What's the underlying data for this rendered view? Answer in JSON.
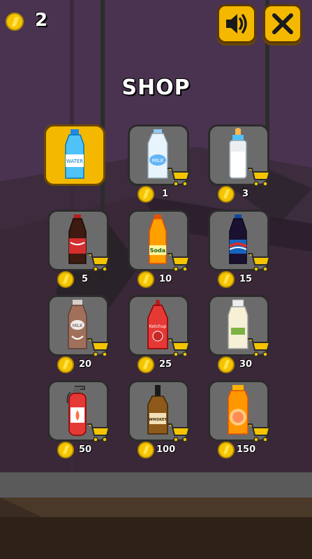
{
  "hud": {
    "coins": "2"
  },
  "header": {
    "title": "SHOP"
  },
  "buttons": {
    "sound_icon": "speaker-icon",
    "close_icon": "close-x-icon"
  },
  "items": [
    {
      "name": "water",
      "label": "WATER",
      "price": "",
      "selected": true
    },
    {
      "name": "milk",
      "label": "MILK",
      "price": "1"
    },
    {
      "name": "baby-bottle",
      "label": "",
      "price": "3"
    },
    {
      "name": "cola",
      "label": "",
      "price": "5"
    },
    {
      "name": "soda",
      "label": "Soda",
      "price": "10"
    },
    {
      "name": "pepsi",
      "label": "",
      "price": "15"
    },
    {
      "name": "choco-milk",
      "label": "MILK",
      "price": "20"
    },
    {
      "name": "ketchup",
      "label": "Ketchup",
      "price": "25"
    },
    {
      "name": "mayo",
      "label": "",
      "price": "30"
    },
    {
      "name": "extinguisher",
      "label": "",
      "price": "50"
    },
    {
      "name": "whiskey",
      "label": "WHISKEY",
      "price": "100"
    },
    {
      "name": "juice",
      "label": "",
      "price": "150"
    }
  ],
  "colors": {
    "accent": "#f5b800",
    "slot": "#6b6b6b",
    "background": "#3d2b3e"
  }
}
